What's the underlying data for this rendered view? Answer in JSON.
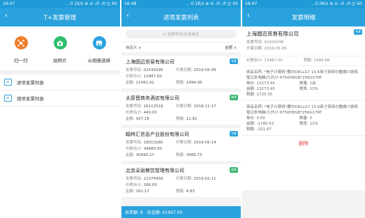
{
  "screen1": {
    "status": {
      "time": "16:47",
      "right": "…0.1K/s ⊕ ⊖ .ıll .ıll ◫ 60"
    },
    "title": "T+发票管理",
    "actions": [
      {
        "label": "扫一扫",
        "color": "#ef7d2a",
        "icon": "scan-icon"
      },
      {
        "label": "拍照片",
        "color": "#2dbf6e",
        "icon": "camera-icon"
      },
      {
        "label": "从相册选择",
        "color": "#2aa2dd",
        "icon": "gallery-icon"
      }
    ],
    "menu": [
      {
        "label": "进项发票列表",
        "icon": "list-icon"
      },
      {
        "label": "销项发票列表",
        "icon": "list-icon"
      }
    ]
  },
  "screen2": {
    "status": {
      "time": "16:48",
      "right": "…0.1K/s ⊕ ⊖ .ıll .ıll ◫ 60"
    },
    "title": "进项发票列表",
    "search_placeholder": "Q 发票号码/往来单位",
    "filter_left": "自定义 ∨",
    "filter_right": "金额 ∨",
    "labels": {
      "invoice_no": "发票号码:",
      "date": "开票日期:",
      "total": "价税合计:",
      "amount": "金额:",
      "tax": "税额:"
    },
    "cards": [
      {
        "company": "上海圆迈贸易有限公司",
        "tag": "专票",
        "invoice_no": "02434296",
        "date": "2019-05-09",
        "total": "12987.00",
        "amount": "11492.92",
        "tax": "1494.08"
      },
      {
        "company": "太原晋商务酒店有限公司",
        "tag": "普票",
        "invoice_no": "16112518",
        "date": "2018-11-17",
        "total": "440.00",
        "amount": "427.18",
        "tax": "12.82"
      },
      {
        "company": "翰林汇信息产业股份有限公司",
        "tag": "专票",
        "invoice_no": "18013280",
        "date": "2019-05-14",
        "total": "34680.00",
        "amount": "30690.27",
        "tax": "3989.73"
      },
      {
        "company": "北京朵丽餐饮管理有限公司",
        "tag": "普票",
        "invoice_no": "21374956",
        "date": "2019-02-11",
        "total": "166.00",
        "amount": "161.17",
        "tax": "4.83"
      }
    ],
    "footer": {
      "count_label": "总单据: 8",
      "sum_label": "总金额: 61967.00"
    }
  },
  "screen3": {
    "status": {
      "time": "16:47",
      "right": "…0.0K/s ⊕ ⊖ .ıll .ıll ◫ 60"
    },
    "title": "发票明细",
    "company": "上海圆迈贸易有限公司",
    "tag": "专票",
    "invoice_no_line": "发票号码: 02434296",
    "date_line": "开票日期: 2019-05-09",
    "total_line": "价税合计: 12987.00",
    "tax_line": "税额: 1494.08",
    "items": [
      {
        "name": "商品名称: *电子计算机*戴尔DELLG7 15.6英寸英特尔酷睿i7游戏笔记本电脑(九代i7-9750H8GB*256G1TRT",
        "price": "单价: 13273.45",
        "qty": "数量: 1台",
        "amount": "金额: 13273.45",
        "rate": "税率: 13%",
        "tax": "税额: 1725.55"
      },
      {
        "name": "商品名称: *电子计算机*戴尔DELLG7 15.6英寸英特尔酷睿i7游戏笔记本电脑(九代i7-9750H8GB*256G1TRT",
        "price": "单价: 0.00",
        "qty": "数量: 0",
        "amount": "金额: -1780.53",
        "rate": "税率: 13%",
        "tax": "税额: -231.47"
      }
    ],
    "delete_label": "删除"
  }
}
